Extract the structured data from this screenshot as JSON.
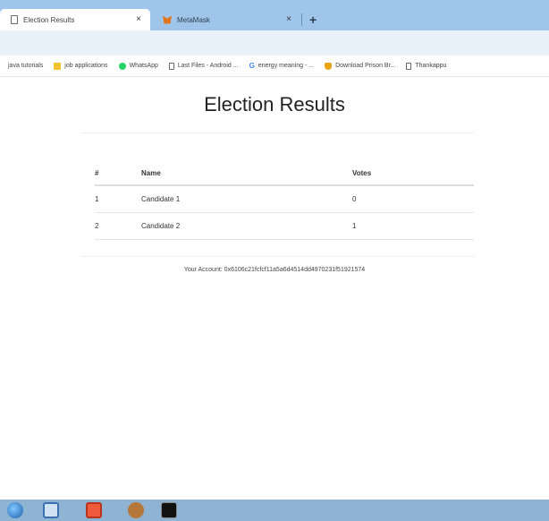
{
  "browser": {
    "tabs": [
      {
        "label": "Election Results",
        "close": "×",
        "active": true
      },
      {
        "label": "MetaMask",
        "close": "×",
        "active": false
      }
    ],
    "new_tab": "+",
    "bookmarks": [
      {
        "label": "java tutorials",
        "icon": "none"
      },
      {
        "label": "job applications",
        "icon": "folder-icon"
      },
      {
        "label": "WhatsApp",
        "icon": "whatsapp-icon"
      },
      {
        "label": "Last Files - Android ...",
        "icon": "page-icon"
      },
      {
        "label": "energy meaning - ...",
        "icon": "google-icon"
      },
      {
        "label": "Download Prison Br...",
        "icon": "shield-icon"
      },
      {
        "label": "Thankappu",
        "icon": "page-icon"
      }
    ]
  },
  "page": {
    "title": "Election Results",
    "table": {
      "headers": [
        "#",
        "Name",
        "Votes"
      ],
      "rows": [
        [
          "1",
          "Candidate 1",
          "0"
        ],
        [
          "2",
          "Candidate 2",
          "1"
        ]
      ]
    },
    "account": "Your Account: 0x6106c21fcfcf11a5a6d4514dd4970231f51921574"
  },
  "taskbar": {
    "items": [
      "start-orb-icon",
      "ie-icon",
      "pdf-icon",
      "app-icon",
      "terminal-icon"
    ]
  },
  "colors": {
    "tabstrip": "#9fc6ea",
    "toolbar": "#e9f1f8",
    "taskbar": "#8fb4d3",
    "metamask": "#e2761b"
  }
}
